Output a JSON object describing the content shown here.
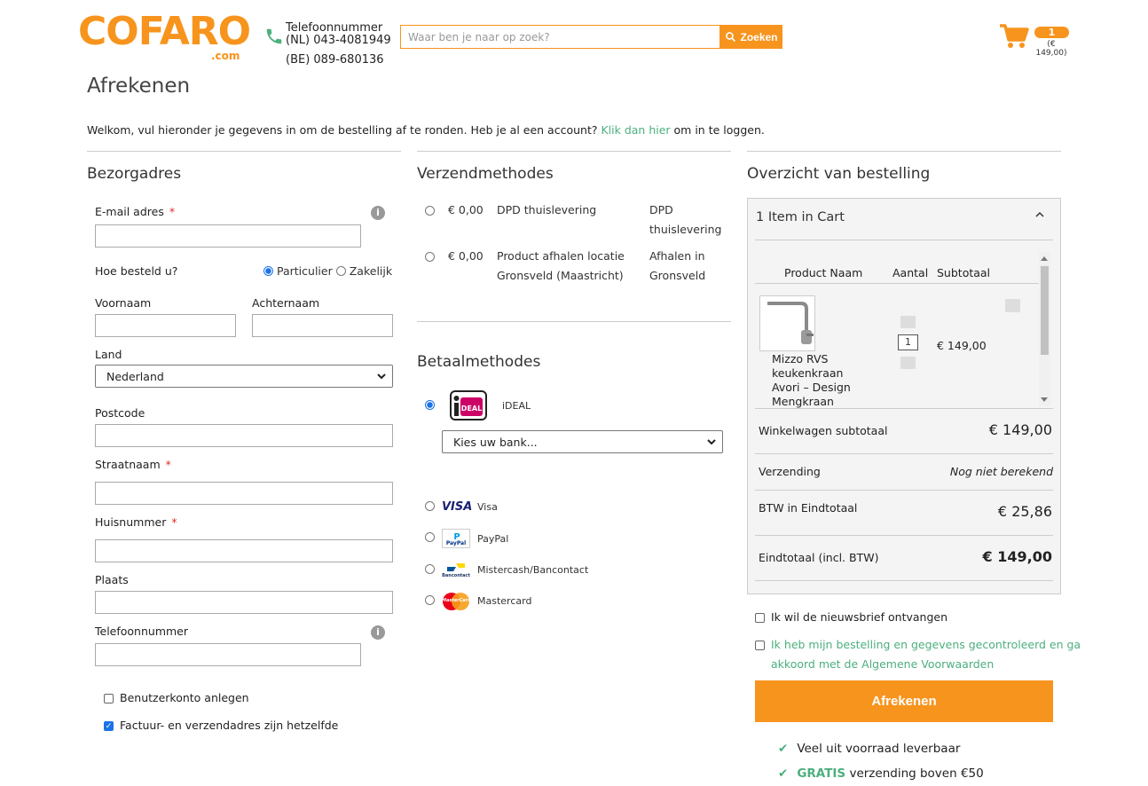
{
  "header": {
    "logo_main": "COFARO",
    "logo_com": ".com",
    "phone_label": "Telefoonnummer",
    "phone_nl": "(NL) 043-4081949",
    "phone_be": "(BE) 089-680136",
    "search_placeholder": "Waar ben je naar op zoek?",
    "search_button": "Zoeken",
    "cart_count": "1",
    "cart_total": "(€ 149,00)"
  },
  "page": {
    "title": "Afrekenen",
    "welcome_pre": "Welkom, vul hieronder je gegevens in om de bestelling af te ronden. Heb je al een account?",
    "welcome_link": "Klik dan hier",
    "welcome_post": "om in te loggen."
  },
  "address": {
    "title": "Bezorgadres",
    "email_label": "E-mail adres",
    "required_mark": "*",
    "order_type_label": "Hoe besteld u?",
    "order_type_private": "Particulier",
    "order_type_business": "Zakelijk",
    "firstname_label": "Voornaam",
    "lastname_label": "Achternaam",
    "country_label": "Land",
    "country_value": "Nederland",
    "postcode_label": "Postcode",
    "street_label": "Straatnaam",
    "housenumber_label": "Huisnummer",
    "city_label": "Plaats",
    "phone_label": "Telefoonnummer",
    "create_account": "Benutzerkonto anlegen",
    "same_address": "Factuur- en verzendadres zijn hetzelfde"
  },
  "shipping": {
    "title": "Verzendmethodes",
    "methods": [
      {
        "price": "€ 0,00",
        "name": "DPD thuislevering",
        "carrier_line1": "DPD",
        "carrier_line2": "thuislevering"
      },
      {
        "price": "€ 0,00",
        "name_line1": "Product afhalen locatie",
        "name_line2": "Gronsveld (Maastricht)",
        "carrier_line1": "Afhalen in",
        "carrier_line2": "Gronsveld"
      }
    ]
  },
  "payment": {
    "title": "Betaalmethodes",
    "ideal_label": "iDEAL",
    "bank_placeholder": "Kies uw bank...",
    "methods": [
      {
        "label": "Visa",
        "logo_text": "VISA"
      },
      {
        "label": "PayPal",
        "logo_text": "PayPal"
      },
      {
        "label": "Mistercash/Bancontact",
        "logo_text": "Bancontact"
      },
      {
        "label": "Mastercard",
        "logo_text": "MasterCard"
      }
    ]
  },
  "summary": {
    "title": "Overzicht van bestelling",
    "items_in_cart": "1 Item in Cart",
    "col_product": "Product Naam",
    "col_qty": "Aantal",
    "col_subtotal": "Subtotaal",
    "product_name_lines": [
      "Mizzo RVS",
      "keukenkraan",
      "Avori – Design",
      "Mengkraan"
    ],
    "product_qty": "1",
    "product_subtotal": "€ 149,00",
    "cart_subtotal_label": "Winkelwagen subtotaal",
    "cart_subtotal_value": "€ 149,00",
    "shipping_label": "Verzending",
    "shipping_value": "Nog niet berekend",
    "vat_label": "BTW in Eindtotaal",
    "vat_value": "€ 25,86",
    "total_label": "Eindtotaal (incl. BTW)",
    "total_value": "€ 149,00",
    "newsletter": "Ik wil de nieuwsbrief ontvangen",
    "terms_line1": "Ik heb mijn bestelling en gegevens gecontroleerd en ga",
    "terms_line2": "akkoord met de Algemene Voorwaarden",
    "checkout_button": "Afrekenen",
    "usp1": "Veel uit voorraad leverbaar",
    "usp2_bold": "GRATIS",
    "usp2_rest": "verzending boven €50"
  },
  "colors": {
    "brand_orange": "#f7941d",
    "link_green": "#4caf7d"
  }
}
